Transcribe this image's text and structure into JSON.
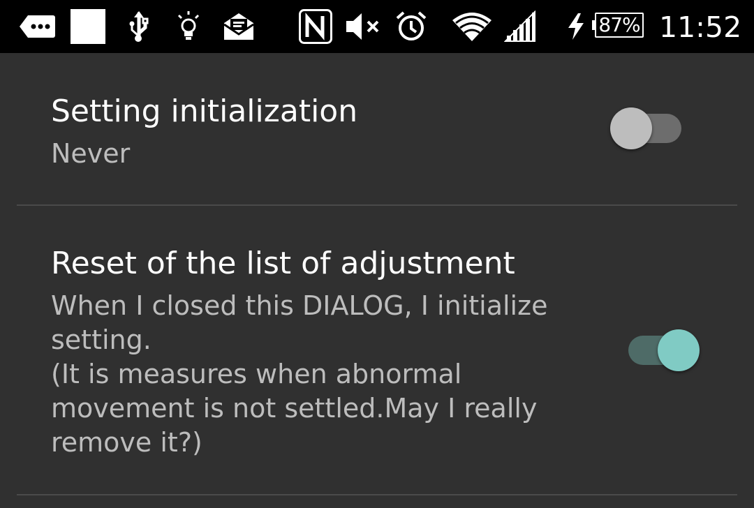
{
  "status_bar": {
    "battery_percent": "87%",
    "time": "11:52",
    "icons": [
      "more-notifications-icon",
      "white-square-icon",
      "usb-icon",
      "lightbulb-icon",
      "email-icon",
      "nfc-icon",
      "mute-icon",
      "alarm-icon",
      "wifi-icon",
      "signal-icon",
      "charging-icon",
      "battery-icon"
    ]
  },
  "settings": [
    {
      "title": "Setting initialization",
      "summary": "Never",
      "switch_on": false
    },
    {
      "title": "Reset of the list of adjustment",
      "summary": "When I closed this DIALOG, I initialize\nsetting.\n(It is measures when abnormal\nmovement is not settled.May I really\nremove it?)",
      "switch_on": true
    }
  ],
  "colors": {
    "background": "#303030",
    "status_bar": "#000000",
    "accent": "#80cbc4",
    "summary_text": "#bdbdbd",
    "divider": "#4a4a4a"
  }
}
